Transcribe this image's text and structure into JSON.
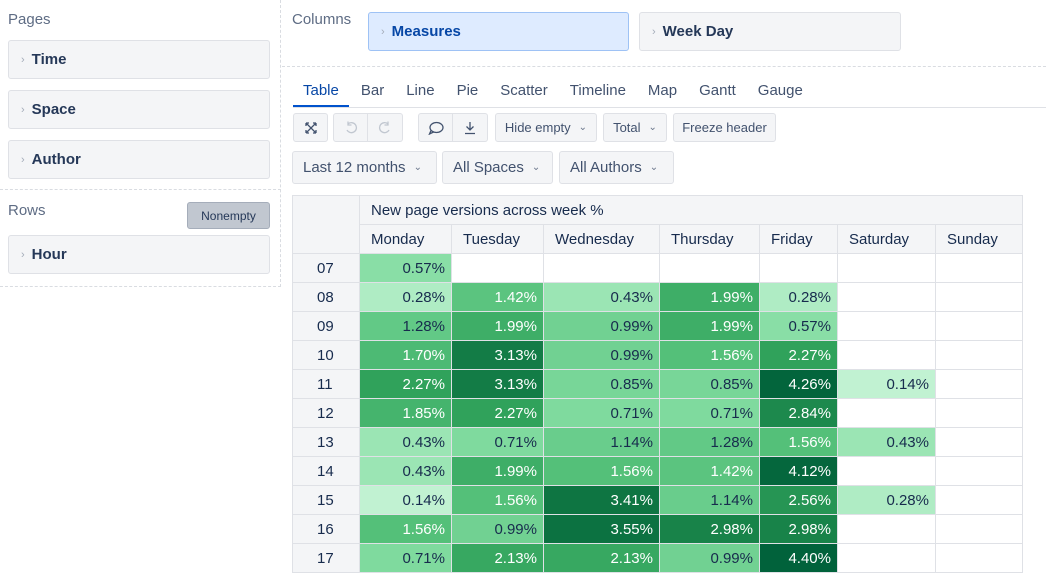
{
  "pages": {
    "label": "Pages",
    "items": [
      "Time",
      "Space",
      "Author"
    ]
  },
  "rows": {
    "label": "Rows",
    "nonempty_label": "Nonempty",
    "items": [
      "Hour"
    ]
  },
  "columns": {
    "label": "Columns",
    "items": [
      "Measures",
      "Week Day"
    ]
  },
  "tabs": [
    "Table",
    "Bar",
    "Line",
    "Pie",
    "Scatter",
    "Timeline",
    "Map",
    "Gantt",
    "Gauge"
  ],
  "active_tab": "Table",
  "toolbar": {
    "expand_icon": "expand-icon",
    "undo_icon": "undo-icon",
    "redo_icon": "redo-icon",
    "comment_icon": "comment-icon",
    "export_icon": "export-icon",
    "hide_empty": "Hide empty",
    "total": "Total",
    "freeze_header": "Freeze header"
  },
  "filters": [
    "Last 12 months",
    "All Spaces",
    "All Authors"
  ],
  "table": {
    "measure_header": "New page versions across week %",
    "columns": [
      "Monday",
      "Tuesday",
      "Wednesday",
      "Thursday",
      "Friday",
      "Saturday",
      "Sunday"
    ],
    "rows": [
      {
        "hour": "07",
        "values": [
          "0.57%",
          "",
          "",
          "",
          "",
          "",
          ""
        ]
      },
      {
        "hour": "08",
        "values": [
          "0.28%",
          "1.42%",
          "0.43%",
          "1.99%",
          "0.28%",
          "",
          ""
        ]
      },
      {
        "hour": "09",
        "values": [
          "1.28%",
          "1.99%",
          "0.99%",
          "1.99%",
          "0.57%",
          "",
          ""
        ]
      },
      {
        "hour": "10",
        "values": [
          "1.70%",
          "3.13%",
          "0.99%",
          "1.56%",
          "2.27%",
          "",
          ""
        ]
      },
      {
        "hour": "11",
        "values": [
          "2.27%",
          "3.13%",
          "0.85%",
          "0.85%",
          "4.26%",
          "0.14%",
          ""
        ]
      },
      {
        "hour": "12",
        "values": [
          "1.85%",
          "2.27%",
          "0.71%",
          "0.71%",
          "2.84%",
          "",
          ""
        ]
      },
      {
        "hour": "13",
        "values": [
          "0.43%",
          "0.71%",
          "1.14%",
          "1.28%",
          "1.56%",
          "0.43%",
          ""
        ]
      },
      {
        "hour": "14",
        "values": [
          "0.43%",
          "1.99%",
          "1.56%",
          "1.42%",
          "4.12%",
          "",
          ""
        ]
      },
      {
        "hour": "15",
        "values": [
          "0.14%",
          "1.56%",
          "3.41%",
          "1.14%",
          "2.56%",
          "0.28%",
          ""
        ]
      },
      {
        "hour": "16",
        "values": [
          "1.56%",
          "0.99%",
          "3.55%",
          "2.98%",
          "2.98%",
          "",
          ""
        ]
      },
      {
        "hour": "17",
        "values": [
          "0.71%",
          "2.13%",
          "2.13%",
          "0.99%",
          "4.40%",
          "",
          ""
        ]
      }
    ]
  },
  "colors": {
    "accent": "#0052cc",
    "heat_low": "#d3f9e0",
    "heat_high": "#00643c"
  }
}
